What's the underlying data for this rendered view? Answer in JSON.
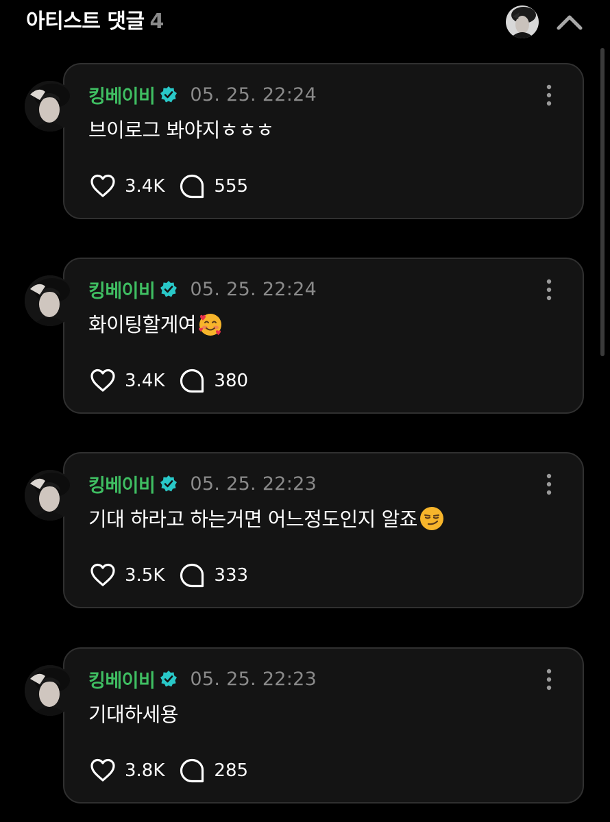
{
  "header": {
    "title": "아티스트 댓글",
    "count": "4",
    "icons": {
      "collapse": "chevron-up-icon",
      "avatar": "artist-avatar"
    }
  },
  "colors": {
    "background": "#000000",
    "card": "#141414",
    "card_border": "#303030",
    "author": "#3fbe62",
    "verified": "#29c8c8",
    "muted": "#8a8a8a",
    "text": "#ffffff"
  },
  "comments": [
    {
      "author": "킹베이비",
      "time": "05. 25. 22:24",
      "text": "브이로그 봐야지ㅎㅎㅎ",
      "emoji": "",
      "likes": "3.4K",
      "replies": "555"
    },
    {
      "author": "킹베이비",
      "time": "05. 25. 22:24",
      "text": "화이팅할게여",
      "emoji": "smiling-face-with-hearts",
      "likes": "3.4K",
      "replies": "380"
    },
    {
      "author": "킹베이비",
      "time": "05. 25. 22:23",
      "text": "기대 하라고 하는거면 어느정도인지 알죠",
      "emoji": "smirking-face",
      "likes": "3.5K",
      "replies": "333"
    },
    {
      "author": "킹베이비",
      "time": "05. 25. 22:23",
      "text": "기대하세용",
      "emoji": "",
      "likes": "3.8K",
      "replies": "285"
    }
  ]
}
